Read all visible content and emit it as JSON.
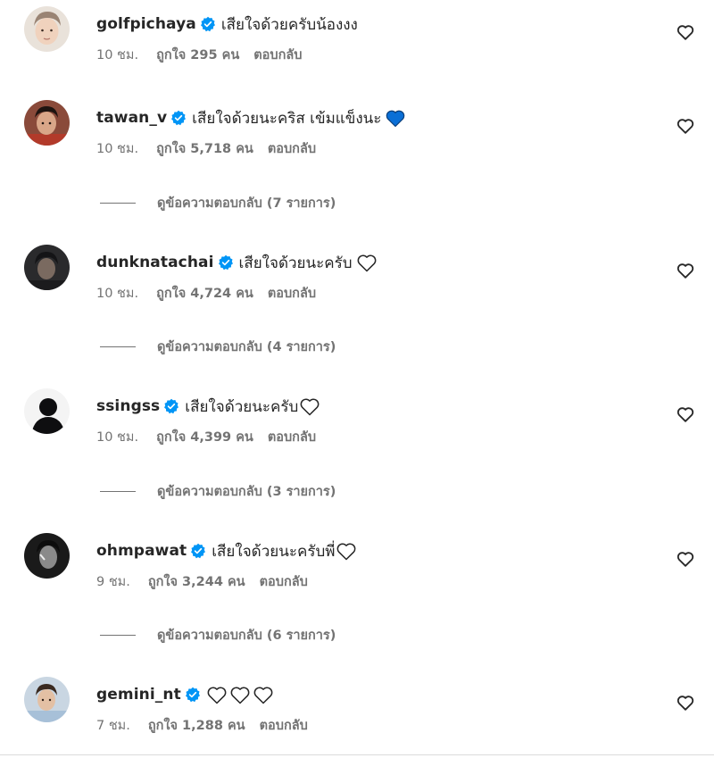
{
  "labels": {
    "likes_word": "ถูกใจ",
    "people_word": "คน",
    "reply": "ตอบกลับ"
  },
  "colors": {
    "text_primary": "#262626",
    "text_secondary": "#737373",
    "verified_badge": "#0095f6",
    "blue_heart": "#0a6fd6"
  },
  "icons": {
    "verified": "verified-badge-icon",
    "like": "heart-outline-icon",
    "blue_heart": "blue-heart-emoji",
    "white_heart": "white-heart-emoji"
  },
  "comments": [
    {
      "username": "golfpichaya",
      "verified": true,
      "text": "เสียใจด้วยครับน้องงง",
      "emoji_hearts": [],
      "time": "10 ชม.",
      "likes_count": "295",
      "view_replies": null
    },
    {
      "username": "tawan_v",
      "verified": true,
      "text": "เสียใจด้วยนะคริส เข้มแข็งนะ",
      "emoji_hearts": [
        "blue"
      ],
      "time": "10 ชม.",
      "likes_count": "5,718",
      "view_replies": "ดูข้อความตอบกลับ (7 รายการ)"
    },
    {
      "username": "dunknatachai",
      "verified": true,
      "text": "เสียใจด้วยนะครับ",
      "emoji_hearts": [
        "white"
      ],
      "time": "10 ชม.",
      "likes_count": "4,724",
      "view_replies": "ดูข้อความตอบกลับ (4 รายการ)"
    },
    {
      "username": "ssingss",
      "verified": true,
      "text": "เสียใจด้วยนะครับ",
      "emoji_hearts": [
        "white"
      ],
      "time": "10 ชม.",
      "likes_count": "4,399",
      "view_replies": "ดูข้อความตอบกลับ (3 รายการ)"
    },
    {
      "username": "ohmpawat",
      "verified": true,
      "text": "เสียใจด้วยนะครับพี่",
      "emoji_hearts": [
        "white"
      ],
      "time": "9 ชม.",
      "likes_count": "3,244",
      "view_replies": "ดูข้อความตอบกลับ (6 รายการ)"
    },
    {
      "username": "gemini_nt",
      "verified": true,
      "text": "",
      "emoji_hearts": [
        "white",
        "white",
        "white"
      ],
      "time": "7 ชม.",
      "likes_count": "1,288",
      "view_replies": null
    }
  ]
}
